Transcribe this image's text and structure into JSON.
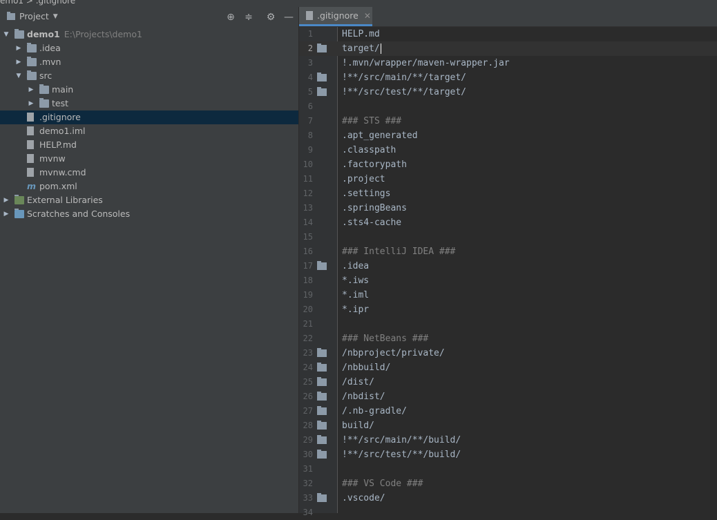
{
  "top_breadcrumb": "emo1 > .gitignore",
  "project_panel": {
    "title": "Project",
    "tools": [
      "locate-icon",
      "collapse-icon",
      "gear-icon",
      "minimize-icon"
    ]
  },
  "tree": [
    {
      "label": "demo1",
      "path": "E:\\Projects\\demo1",
      "depth": 0,
      "expanded": true,
      "icon": "module-folder-icon"
    },
    {
      "label": ".idea",
      "depth": 1,
      "expanded": false,
      "icon": "folder-icon"
    },
    {
      "label": ".mvn",
      "depth": 1,
      "expanded": false,
      "icon": "folder-icon"
    },
    {
      "label": "src",
      "depth": 1,
      "expanded": true,
      "icon": "folder-icon"
    },
    {
      "label": "main",
      "depth": 2,
      "expanded": false,
      "icon": "folder-icon"
    },
    {
      "label": "test",
      "depth": 2,
      "expanded": false,
      "icon": "folder-icon"
    },
    {
      "label": ".gitignore",
      "depth": 1,
      "icon": "gitignore-file-icon",
      "selected": true
    },
    {
      "label": "demo1.iml",
      "depth": 1,
      "icon": "iml-file-icon"
    },
    {
      "label": "HELP.md",
      "depth": 1,
      "icon": "markdown-file-icon"
    },
    {
      "label": "mvnw",
      "depth": 1,
      "icon": "shell-file-icon"
    },
    {
      "label": "mvnw.cmd",
      "depth": 1,
      "icon": "text-file-icon"
    },
    {
      "label": "pom.xml",
      "depth": 1,
      "icon": "maven-file-icon"
    },
    {
      "label": "External Libraries",
      "depth": 0,
      "expanded": false,
      "icon": "libraries-icon"
    },
    {
      "label": "Scratches and Consoles",
      "depth": 0,
      "expanded": false,
      "icon": "scratches-icon"
    }
  ],
  "editor": {
    "tab_label": ".gitignore",
    "current_line": 2,
    "lines": [
      {
        "n": "1",
        "text": "HELP.md"
      },
      {
        "n": "2",
        "text": "target/",
        "folder": true
      },
      {
        "n": "3",
        "text": "!.mvn/wrapper/maven-wrapper.jar"
      },
      {
        "n": "4",
        "text": "!**/src/main/**/target/",
        "folder": true
      },
      {
        "n": "5",
        "text": "!**/src/test/**/target/",
        "folder": true
      },
      {
        "n": "6",
        "text": ""
      },
      {
        "n": "7",
        "text": "### STS ###",
        "comment": true
      },
      {
        "n": "8",
        "text": ".apt_generated"
      },
      {
        "n": "9",
        "text": ".classpath"
      },
      {
        "n": "10",
        "text": ".factorypath"
      },
      {
        "n": "11",
        "text": ".project"
      },
      {
        "n": "12",
        "text": ".settings"
      },
      {
        "n": "13",
        "text": ".springBeans"
      },
      {
        "n": "14",
        "text": ".sts4-cache"
      },
      {
        "n": "15",
        "text": ""
      },
      {
        "n": "16",
        "text": "### IntelliJ IDEA ###",
        "comment": true
      },
      {
        "n": "17",
        "text": ".idea",
        "folder": true
      },
      {
        "n": "18",
        "text": "*.iws"
      },
      {
        "n": "19",
        "text": "*.iml"
      },
      {
        "n": "20",
        "text": "*.ipr"
      },
      {
        "n": "21",
        "text": ""
      },
      {
        "n": "22",
        "text": "### NetBeans ###",
        "comment": true
      },
      {
        "n": "23",
        "text": "/nbproject/private/",
        "folder": true
      },
      {
        "n": "24",
        "text": "/nbbuild/",
        "folder": true
      },
      {
        "n": "25",
        "text": "/dist/",
        "folder": true
      },
      {
        "n": "26",
        "text": "/nbdist/",
        "folder": true
      },
      {
        "n": "27",
        "text": "/.nb-gradle/",
        "folder": true
      },
      {
        "n": "28",
        "text": "build/",
        "folder": true
      },
      {
        "n": "29",
        "text": "!**/src/main/**/build/",
        "folder": true
      },
      {
        "n": "30",
        "text": "!**/src/test/**/build/",
        "folder": true
      },
      {
        "n": "31",
        "text": ""
      },
      {
        "n": "32",
        "text": "### VS Code ###",
        "comment": true
      },
      {
        "n": "33",
        "text": ".vscode/",
        "folder": true
      },
      {
        "n": "34",
        "text": ""
      }
    ]
  }
}
